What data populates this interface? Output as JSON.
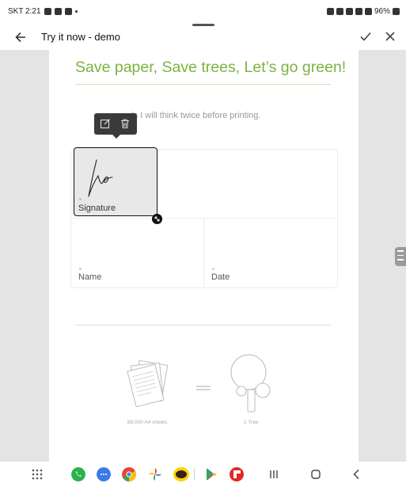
{
  "status_bar": {
    "time": "SKT 2:21",
    "battery": "96%"
  },
  "app_bar": {
    "title": "Try it now - demo"
  },
  "document": {
    "headline": "Save paper, Save trees, Let’s go green!",
    "pledge": "y onwards I will think twice before printing.",
    "signature_label": "Signature",
    "name_label": "Name",
    "date_label": "Date",
    "sheets_caption": "88,000 A4 sheets",
    "tree_caption": "1 Tree"
  },
  "colors": {
    "accent_green": "#7cb342",
    "toolbar_bg": "#3a3a3a"
  },
  "icons": {
    "back": "arrow-back-icon",
    "confirm": "check-icon",
    "close": "close-icon",
    "edit": "edit-icon",
    "delete": "trash-icon",
    "resize": "resize-handle-icon"
  },
  "taskbar": {
    "apps": [
      "apps-grid",
      "phone",
      "messages",
      "chrome",
      "photos",
      "kakaotalk",
      "play-store",
      "flipboard"
    ],
    "nav": [
      "recents",
      "home",
      "back"
    ]
  }
}
